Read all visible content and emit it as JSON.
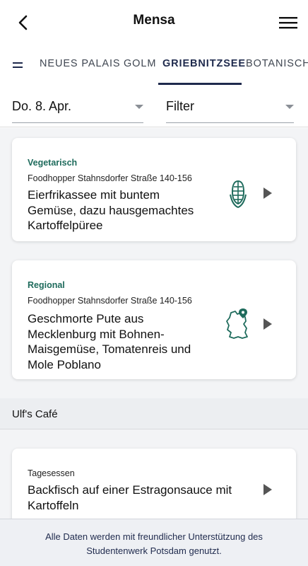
{
  "header": {
    "title": "Mensa"
  },
  "tabs": [
    {
      "label": "NEUES PALAIS",
      "active": false
    },
    {
      "label": "GOLM",
      "active": false
    },
    {
      "label": "GRIEBNITZSEE",
      "active": true
    },
    {
      "label": "BOTANISCH",
      "active": false
    }
  ],
  "filters": {
    "date": "Do. 8. Apr.",
    "filter": "Filter"
  },
  "cards": [
    {
      "category": "Vegetarisch",
      "location": "Foodhopper Stahnsdorfer Straße 140-156",
      "dish": "Eierfrikassee mit buntem Gemüse, dazu hausgemachtes Kartoffelpüree",
      "icon": "corn-icon"
    },
    {
      "category": "Regional",
      "location": "Foodhopper Stahnsdorfer Straße 140-156",
      "dish": "Geschmorte Pute aus Mecklenburg mit Bohnen-Maisgemüse, Tomatenreis und Mole Poblano",
      "icon": "germany-map-pin-icon"
    },
    {
      "category": "Tagesessen",
      "location": "",
      "dish": "Backfisch auf einer Estragonsauce mit Kartoffeln",
      "icon": ""
    }
  ],
  "section": {
    "title": "Ulf's Café"
  },
  "footer": {
    "text": "Alle Daten werden mit freundlicher Unterstützung des Studentenwerk Potsdam genutzt."
  },
  "colors": {
    "accent": "#1e6b5c",
    "navy": "#1f2a4d"
  }
}
